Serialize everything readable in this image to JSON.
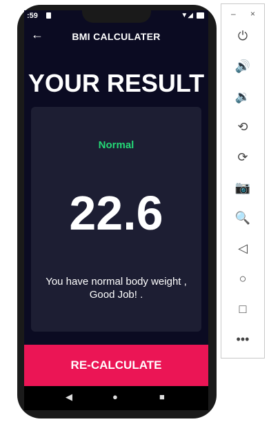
{
  "status_bar": {
    "time": ":59"
  },
  "app_bar": {
    "back_icon": "arrow-left-icon",
    "title": "BMI CALCULATER"
  },
  "result": {
    "heading": "YOUR RESULT",
    "status_text": "Normal",
    "status_color": "#24d876",
    "bmi_value": "22.6",
    "message": "You have normal body weight , Good Job! ."
  },
  "recalculate_button": {
    "label": "RE-CALCULATE",
    "color": "#eb1555"
  },
  "nav_bar": {
    "back": "◀",
    "home": "●",
    "recents": "■"
  },
  "emulator_toolbar": {
    "minimize": "–",
    "close": "×",
    "tools": [
      {
        "name": "power-icon",
        "glyph": "⏻"
      },
      {
        "name": "volume-up-icon",
        "glyph": "🔊"
      },
      {
        "name": "volume-down-icon",
        "glyph": "🔉"
      },
      {
        "name": "rotate-left-icon",
        "glyph": "⟲"
      },
      {
        "name": "rotate-right-icon",
        "glyph": "⟳"
      },
      {
        "name": "camera-icon",
        "glyph": "📷"
      },
      {
        "name": "zoom-icon",
        "glyph": "🔍"
      },
      {
        "name": "back-icon",
        "glyph": "◁"
      },
      {
        "name": "home-icon",
        "glyph": "○"
      },
      {
        "name": "overview-icon",
        "glyph": "□"
      },
      {
        "name": "more-icon",
        "glyph": "•••"
      }
    ]
  }
}
